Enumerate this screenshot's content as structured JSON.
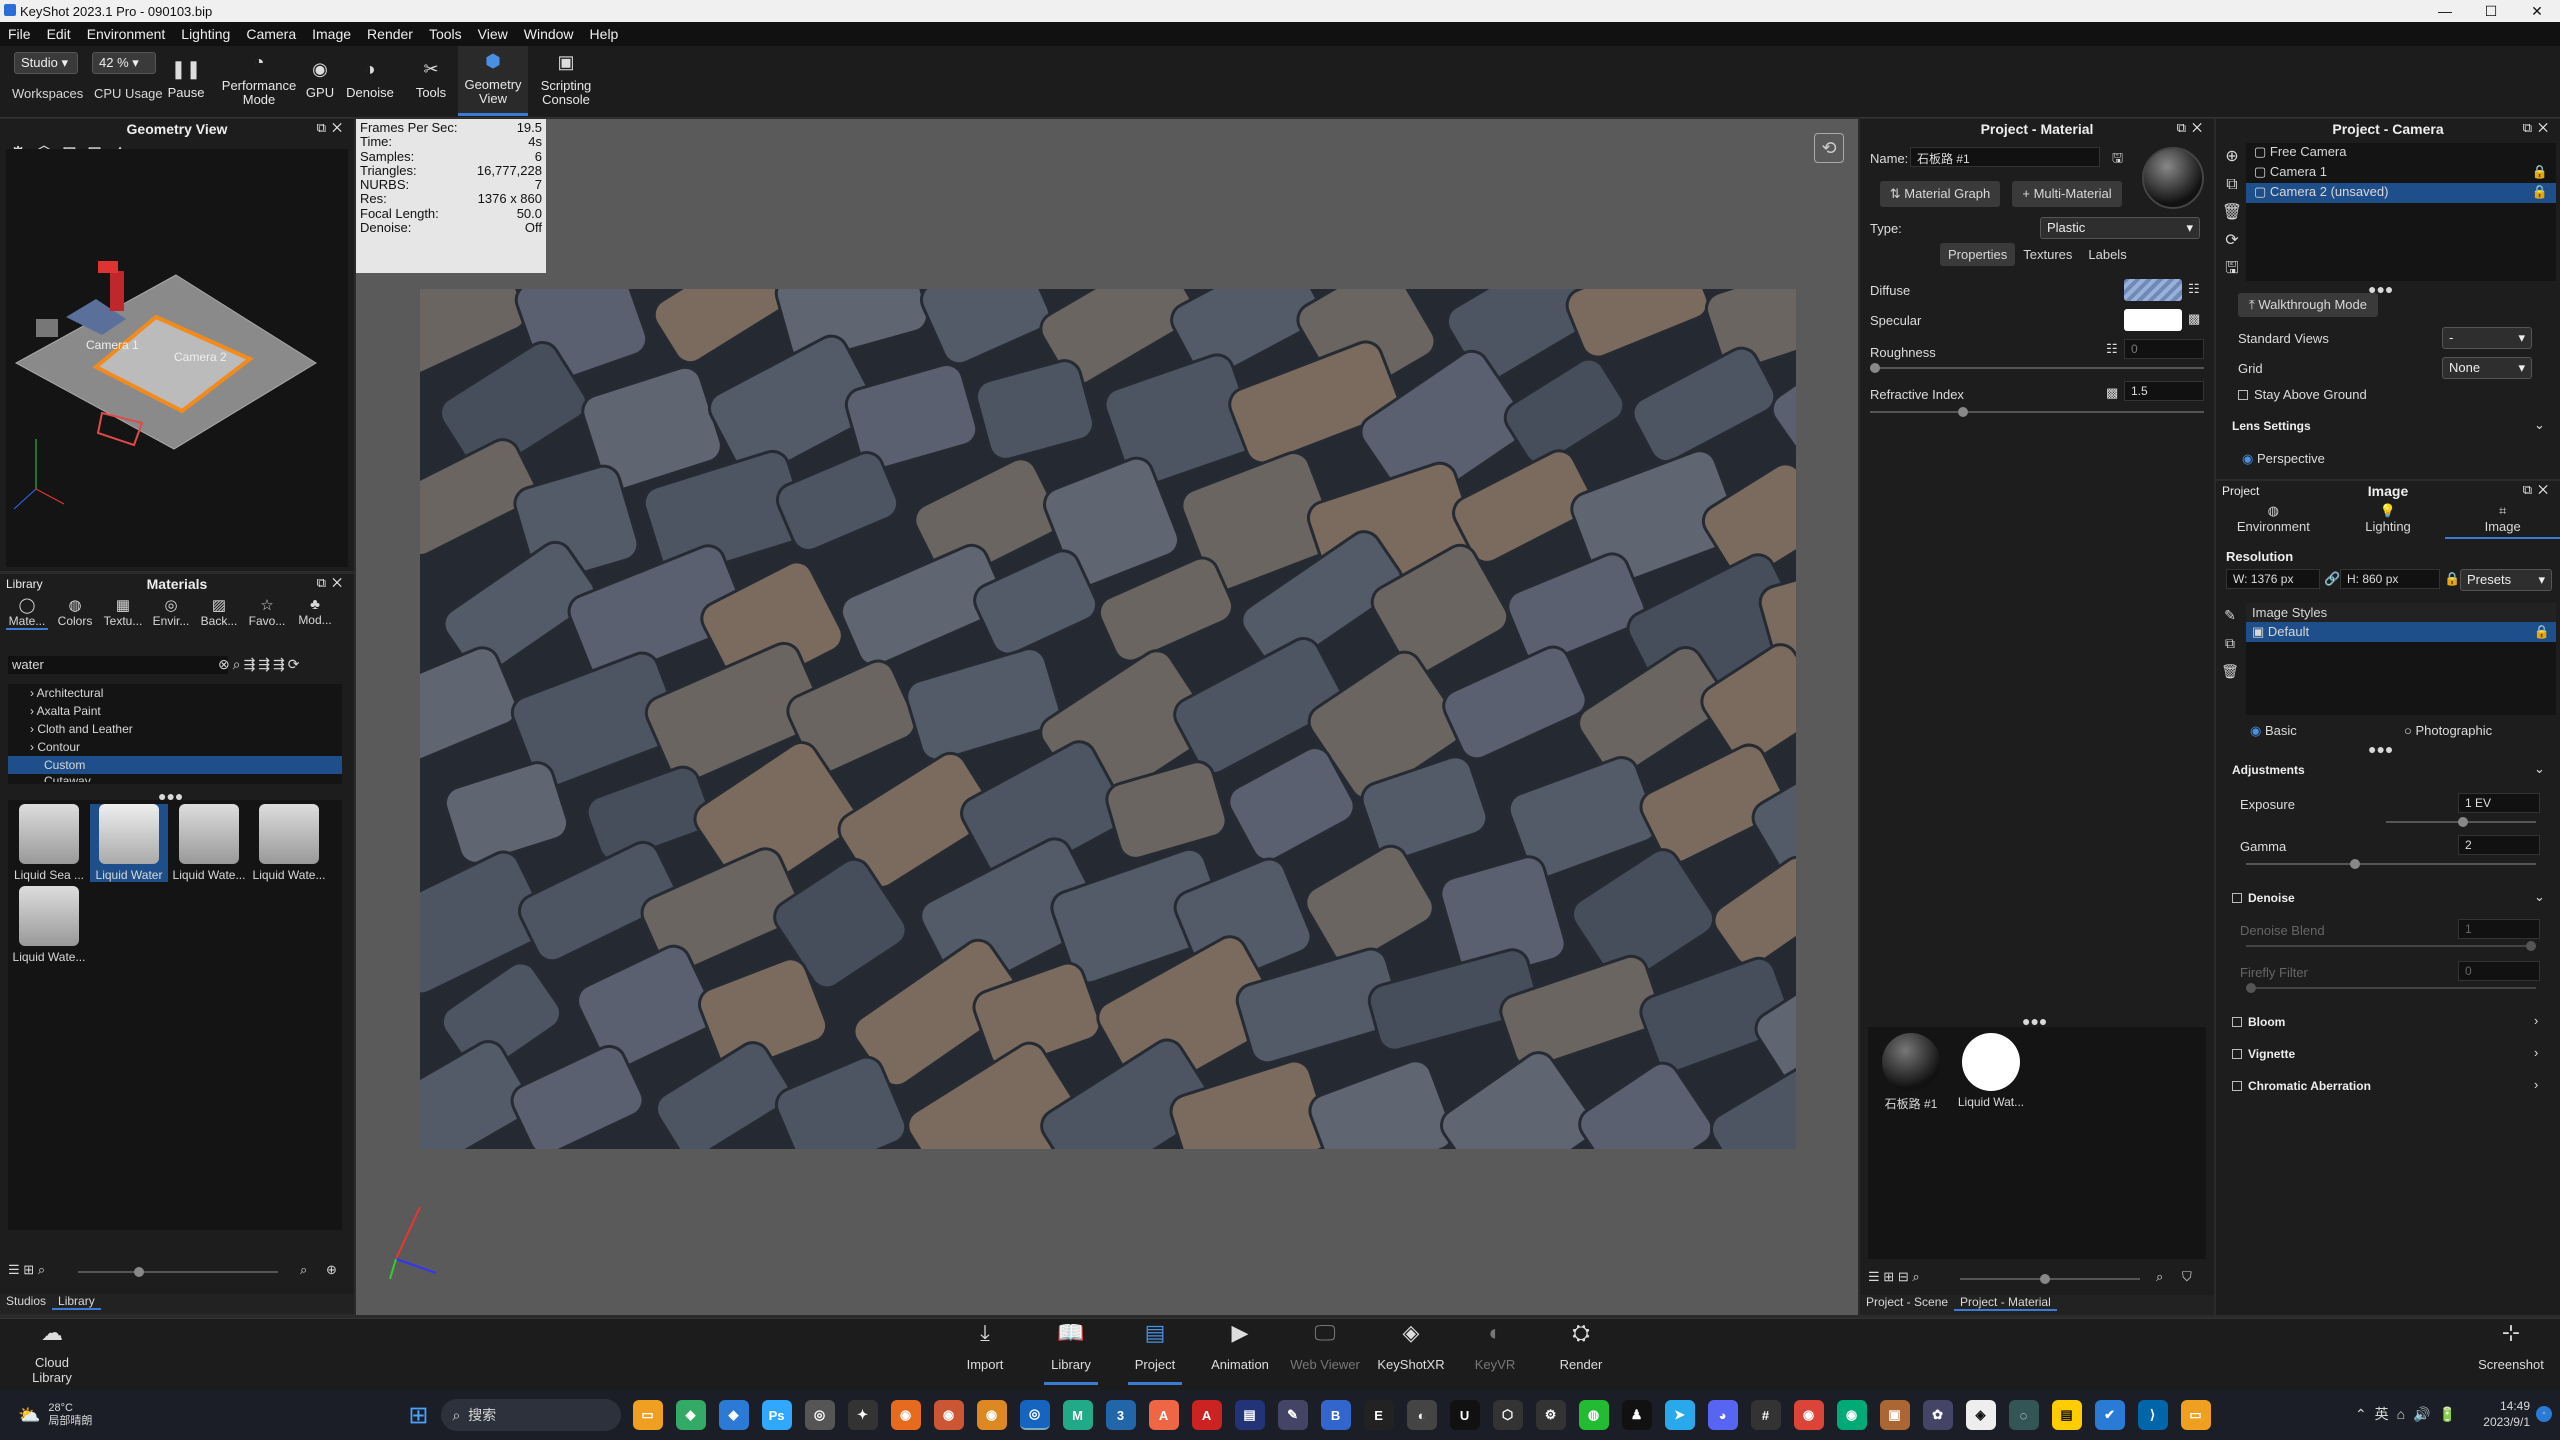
{
  "window": {
    "title": "KeyShot 2023.1 Pro  - 090103.bip",
    "controls": [
      "—",
      "☐",
      "✕"
    ]
  },
  "menu": [
    "File",
    "Edit",
    "Environment",
    "Lighting",
    "Camera",
    "Image",
    "Render",
    "Tools",
    "View",
    "Window",
    "Help"
  ],
  "ribbon": {
    "workspace_value": "Studio",
    "workspace_label": "Workspaces",
    "zoom_value": "42 %",
    "cpu_label": "CPU Usage",
    "pause_label": "Pause",
    "perf_label": "Performance Mode",
    "gpu_label": "GPU",
    "denoise_label": "Denoise",
    "tools_label": "Tools",
    "geom_label": "Geometry View",
    "script_label": "Scripting Console"
  },
  "geometry_view": {
    "title": "Geometry View",
    "cam1": "Camera 1",
    "cam2": "Camera 2"
  },
  "library": {
    "tab": "Library",
    "title": "Materials",
    "tabs": [
      "Mate...",
      "Colors",
      "Textu...",
      "Envir...",
      "Back...",
      "Favo...",
      "Mod..."
    ],
    "search": "water",
    "tree": [
      "Architectural",
      "Axalta Paint",
      "Cloth and Leather",
      "Contour",
      "Custom",
      "Cutaway"
    ],
    "thumbs": [
      "Liquid Sea ...",
      "Liquid Water",
      "Liquid Wate...",
      "Liquid Wate...",
      "Liquid Wate..."
    ],
    "bottom_tabs": [
      "Studios",
      "Library"
    ]
  },
  "stats": {
    "labels": [
      "Frames Per Sec:",
      "Time:",
      "Samples:",
      "Triangles:",
      "NURBS:",
      "Res:",
      "Focal Length:",
      "Denoise:"
    ],
    "values": [
      "19.5",
      "4s",
      "6",
      "16,777,228",
      "7",
      "1376 x 860",
      "50.0",
      "Off"
    ]
  },
  "material": {
    "title": "Project - Material",
    "name_label": "Name:",
    "name_value": "石板路 #1",
    "graph_btn": "Material Graph",
    "multi_btn": "Multi-Material",
    "type_label": "Type:",
    "type_value": "Plastic",
    "tabs": [
      "Properties",
      "Textures",
      "Labels"
    ],
    "diffuse": "Diffuse",
    "specular": "Specular",
    "roughness": "Roughness",
    "roughness_value": "0",
    "refr": "Refractive Index",
    "refr_value": "1.5",
    "swatches": [
      "石板路 #1",
      "Liquid Wat..."
    ],
    "bottom_tabs": [
      "Project - Scene",
      "Project - Material"
    ]
  },
  "camera": {
    "title": "Project - Camera",
    "list": [
      "Free Camera",
      "Camera 1",
      "Camera 2 (unsaved)"
    ],
    "walk": "Walkthrough Mode",
    "std_views": "Standard Views",
    "std_value": "-",
    "grid": "Grid",
    "grid_value": "None",
    "stay": "Stay Above Ground",
    "lens": "Lens Settings",
    "persp": "Perspective"
  },
  "image": {
    "project_label": "Project",
    "title": "Image",
    "tabs": [
      "Environment",
      "Lighting",
      "Image"
    ],
    "resolution": "Resolution",
    "w": "W: 1376 px",
    "h": "H: 860 px",
    "presets": "Presets",
    "styles_header": "Image Styles",
    "style_default": "Default",
    "basic": "Basic",
    "photo": "Photographic",
    "adjustments": "Adjustments",
    "exposure": "Exposure",
    "exposure_value": "1 EV",
    "gamma": "Gamma",
    "gamma_value": "2",
    "denoise": "Denoise",
    "denoise_blend": "Denoise Blend",
    "denoise_blend_value": "1",
    "firefly": "Firefly Filter",
    "firefly_value": "0",
    "bloom": "Bloom",
    "vignette": "Vignette",
    "chromatic": "Chromatic Aberration"
  },
  "bottombar": {
    "cloud": "Cloud Library",
    "items": [
      "Import",
      "Library",
      "Project",
      "Animation",
      "Web Viewer",
      "KeyShotXR",
      "KeyVR",
      "Render"
    ],
    "screenshot": "Screenshot"
  },
  "taskbar": {
    "weather_temp": "28°C",
    "weather_desc": "局部晴朗",
    "search": "搜索",
    "time": "14:49",
    "date": "2023/9/1",
    "lang": "英"
  }
}
